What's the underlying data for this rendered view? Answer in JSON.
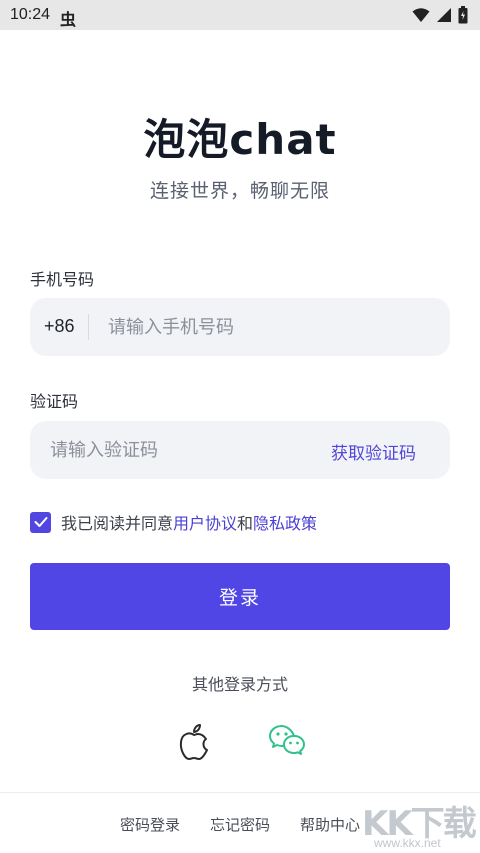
{
  "status_bar": {
    "time": "10:24",
    "app_icon": "虫",
    "icons": [
      "wifi-icon",
      "signal-icon",
      "battery-icon"
    ]
  },
  "header": {
    "title": "泡泡chat",
    "subtitle": "连接世界，畅聊无限"
  },
  "form": {
    "phone_label": "手机号码",
    "country_code": "+86",
    "phone_placeholder": "请输入手机号码",
    "phone_value": "",
    "code_label": "验证码",
    "code_placeholder": "请输入验证码",
    "code_value": "",
    "get_code_label": "获取验证码"
  },
  "agreement": {
    "checked": true,
    "prefix": "我已阅读并同意",
    "user_agreement": "用户协议",
    "conjunction": "和",
    "privacy_policy": "隐私政策"
  },
  "login_button_label": "登录",
  "other_login": {
    "label": "其他登录方式",
    "methods": [
      "apple-icon",
      "wechat-icon"
    ]
  },
  "footer": {
    "links": [
      "密码登录",
      "忘记密码",
      "帮助中心"
    ]
  },
  "watermark": {
    "logo": "KK下载",
    "url": "www.kkx.net"
  },
  "colors": {
    "accent": "#5046e5",
    "link": "#4a3fd6",
    "input_bg": "#f2f3f6",
    "wechat": "#2fc28a"
  }
}
